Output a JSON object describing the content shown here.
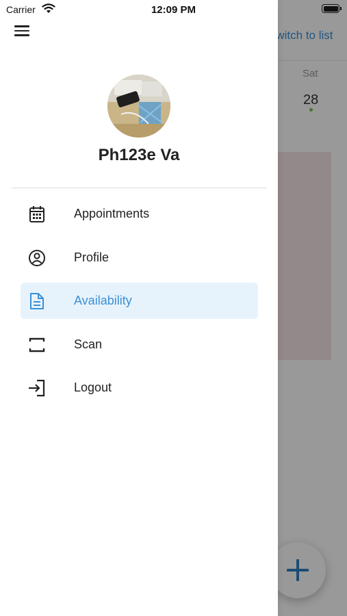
{
  "status_bar": {
    "carrier": "Carrier",
    "time": "12:09 PM"
  },
  "background_screen": {
    "switch_link": "Switch to list",
    "weekday": "Sat",
    "date": "28"
  },
  "drawer": {
    "user_name": "Ph123e Va",
    "items": [
      {
        "label": "Appointments",
        "icon": "calendar-icon",
        "active": false
      },
      {
        "label": "Profile",
        "icon": "user-circle-icon",
        "active": false
      },
      {
        "label": "Availability",
        "icon": "document-icon",
        "active": true
      },
      {
        "label": "Scan",
        "icon": "scan-icon",
        "active": false
      },
      {
        "label": "Logout",
        "icon": "logout-icon",
        "active": false
      }
    ]
  },
  "colors": {
    "accent": "#3a8fd6",
    "active_bg": "#e7f3fc",
    "text": "#222222"
  }
}
